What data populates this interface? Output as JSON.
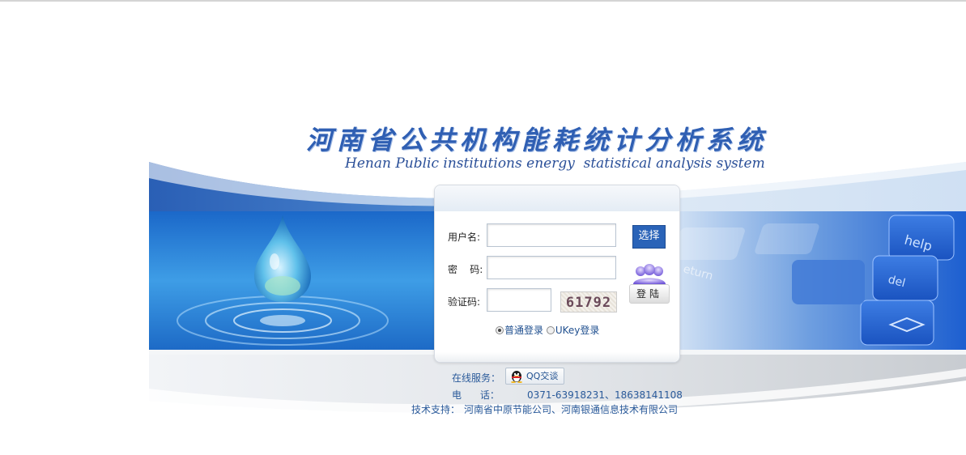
{
  "header": {
    "title_cn": "河南省公共机构能耗统计分析系统",
    "title_en": "Henan Public institutions energy  statistical analysis system"
  },
  "keyboard": {
    "key_help": "help",
    "key_del": "del",
    "key_return": "eturn"
  },
  "login": {
    "username_label": "用户名:",
    "password_label": "密    码:",
    "captcha_label": "验证码:",
    "username_value": "",
    "password_value": "",
    "captcha_value": "",
    "select_button": "选择",
    "captcha_text": "61792",
    "login_button": "登陆",
    "login_modes": [
      "普通登录",
      "UKey登录"
    ],
    "selected_mode": "普通登录"
  },
  "footer": {
    "online_service_label": "在线服务：",
    "qq_button": "QQ交谈",
    "phone_label": "电      话：",
    "phone_value": "0371-63918231、18638141108",
    "support_label": "技术支持：",
    "support_value": "河南省中原节能公司、河南银通信息技术有限公司"
  },
  "colors": {
    "brand_blue": "#2a63b8",
    "title_blue": "#2f5fb3",
    "link_blue": "#2a5a9a"
  }
}
